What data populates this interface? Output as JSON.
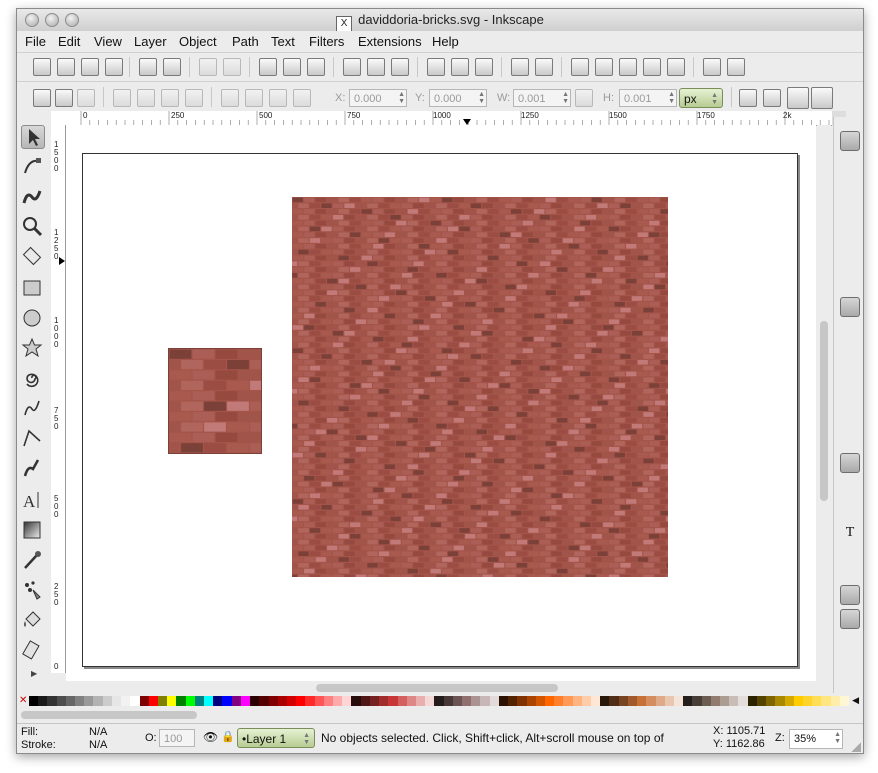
{
  "window": {
    "title": "daviddoria-bricks.svg - Inkscape",
    "title_icon": "X"
  },
  "menu": [
    "File",
    "Edit",
    "View",
    "Layer",
    "Object",
    "Path",
    "Text",
    "Filters",
    "Extensions",
    "Help"
  ],
  "tool_controls": {
    "x_label": "X:",
    "x_value": "0.000",
    "y_label": "Y:",
    "y_value": "0.000",
    "w_label": "W:",
    "w_value": "0.001",
    "h_label": "H:",
    "h_value": "0.001",
    "unit": "px"
  },
  "ruler": {
    "h_ticks": [
      "0",
      "250",
      "500",
      "750",
      "1000",
      "1250",
      "1500",
      "1750",
      "2k"
    ],
    "v_ticks": [
      "1\n5\n0\n0",
      "1\n2\n5\n0",
      "1\n0\n0\n0",
      "7\n5\n0",
      "5\n0\n0",
      "2\n5\n0",
      "0"
    ]
  },
  "toolbox": [
    "selector-tool",
    "node-tool",
    "tweak-tool",
    "zoom-tool",
    "measure-tool",
    "rectangle-tool",
    "ellipse-tool",
    "star-tool",
    "spiral-tool",
    "pencil-tool",
    "pen-tool",
    "calligraphy-tool",
    "text-tool",
    "gradient-tool",
    "dropper-tool",
    "spray-tool",
    "paint-bucket-tool",
    "eraser-tool"
  ],
  "status": {
    "fill_label": "Fill:",
    "fill_value": "N/A",
    "stroke_label": "Stroke:",
    "stroke_value": "N/A",
    "opacity_label": "O:",
    "opacity_value": "100",
    "layer": "•Layer 1",
    "message": "No objects selected. Click, Shift+click, Alt+scroll mouse on top of",
    "cursor_x": "X: 1105.71",
    "cursor_y": "Y: 1162.86",
    "zoom_label": "Z:",
    "zoom_value": "35%"
  },
  "colors": {
    "brick": "#a45449",
    "brick_dark": "#7b4038",
    "brick_light": "#c27a78",
    "accent_green": "#b7cc92"
  },
  "palette": [
    "#000000",
    "#1a1a1a",
    "#333333",
    "#4d4d4d",
    "#666666",
    "#808080",
    "#999999",
    "#b3b3b3",
    "#cccccc",
    "#e6e6e6",
    "#f2f2f2",
    "#ffffff",
    "#800000",
    "#ff0000",
    "#808000",
    "#ffff00",
    "#008000",
    "#00ff00",
    "#008080",
    "#00ffff",
    "#000080",
    "#0000ff",
    "#800080",
    "#ff00ff",
    "#2b0000",
    "#550000",
    "#800000",
    "#aa0000",
    "#d40000",
    "#ff0000",
    "#ff2a2a",
    "#ff5555",
    "#ff8080",
    "#ffaaaa",
    "#ffd5d5",
    "#280b0b",
    "#501616",
    "#782121",
    "#a02c2c",
    "#c83737",
    "#d35f5f",
    "#de8787",
    "#e9afaf",
    "#f4d7d7",
    "#241c1c",
    "#483737",
    "#6c5353",
    "#916f6f",
    "#ac9393",
    "#c8b7b7",
    "#e3dbdb",
    "#2b1100",
    "#552200",
    "#803300",
    "#aa4400",
    "#d45500",
    "#ff6600",
    "#ff7f2a",
    "#ff9955",
    "#ffb380",
    "#ffccaa",
    "#ffe6d5",
    "#28170b",
    "#502d16",
    "#784421",
    "#a05a2c",
    "#c87137",
    "#d38d5f",
    "#deaa87",
    "#e9c6af",
    "#f4e3d7",
    "#241f1c",
    "#483e37",
    "#6c5d53",
    "#917c6f",
    "#ac9d93",
    "#c8beb7",
    "#e3dedb",
    "#2b2200",
    "#554400",
    "#806600",
    "#aa8800",
    "#d4aa00",
    "#ffcc00",
    "#ffd42a",
    "#ffdd55",
    "#ffe680",
    "#ffeeaa",
    "#fff6d5"
  ]
}
